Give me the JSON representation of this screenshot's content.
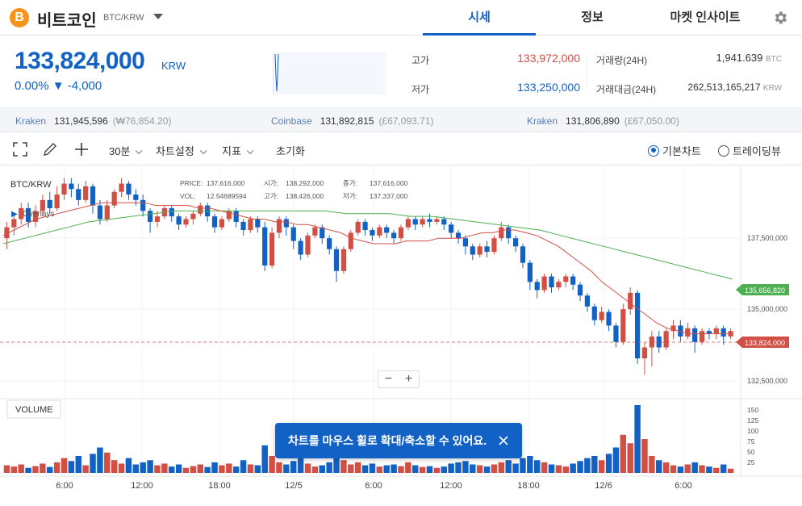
{
  "header": {
    "coin_symbol_glyph": "B",
    "coin_name": "비트코인",
    "pair": "BTC/KRW",
    "tabs": [
      {
        "label": "시세",
        "active": true
      },
      {
        "label": "정보",
        "active": false
      },
      {
        "label": "마켓 인사이트",
        "active": false
      }
    ],
    "settings_icon": "gear-icon"
  },
  "summary": {
    "price": "133,824,000",
    "unit": "KRW",
    "change": "0.00% ▼ -4,000",
    "high_label": "고가",
    "high_value": "133,972,000",
    "low_label": "저가",
    "low_value": "133,250,000",
    "volume_label": "거래량(24H)",
    "volume_value": "1,941.639",
    "volume_unit": "BTC",
    "amount_label": "거래대금(24H)",
    "amount_value": "262,513,165,217",
    "amount_unit": "KRW"
  },
  "exchanges": [
    {
      "name": "Kraken",
      "price": "131,945,596",
      "usd": "(₩76,854.20)"
    },
    {
      "name": "Coinbase",
      "price": "131,892,815",
      "usd": "(£67,093.71)"
    },
    {
      "name": "Kraken",
      "price": "131,806,890",
      "usd": "(£67,050.00)"
    }
  ],
  "toolbar": {
    "interval": "30분",
    "chart_settings": "차트설정",
    "indicators": "지표",
    "reset": "초기화",
    "basic_chart": "기본차트",
    "tradingview": "트레이딩뷰"
  },
  "chart": {
    "pair_label": "BTC/KRW",
    "overlays": "Overlays",
    "legend": {
      "price_label": "PRICE:",
      "price": "137,616,000",
      "open_label": "시가:",
      "open": "138,292,000",
      "close_label": "종가:",
      "close": "137,616,000",
      "vol_label": "VOL:",
      "vol": "12.54689594",
      "high_label": "고가:",
      "high": "138,426,000",
      "low_label": "저가:",
      "low": "137,337,000"
    },
    "y_ticks": [
      "137,500,000",
      "135,000,000",
      "132,500,000"
    ],
    "ma_long_tag": "135,656,820",
    "current_tag": "133,824,000",
    "volume_label": "VOLUME",
    "vol_ticks": [
      "150",
      "125",
      "100",
      "75",
      "50",
      "25"
    ],
    "x_ticks": [
      "6:00",
      "12:00",
      "18:00",
      "12/5",
      "6:00",
      "12:00",
      "18:00",
      "12/6",
      "6:00"
    ],
    "colors": {
      "up": "#d24f45",
      "down": "#1261c4",
      "ma_short": "#d24f45",
      "ma_long": "#4caf50"
    }
  },
  "chart_data": {
    "type": "candlestick",
    "y_range": [
      131500000,
      139600000
    ],
    "vol_range": [
      0,
      160
    ],
    "candles": [
      [
        137.2,
        137.6,
        136.8,
        137.8,
        18
      ],
      [
        137.6,
        137.9,
        137.3,
        138.1,
        15
      ],
      [
        137.9,
        138.3,
        137.7,
        138.5,
        20
      ],
      [
        138.3,
        137.8,
        137.6,
        138.5,
        12
      ],
      [
        137.8,
        138.2,
        137.6,
        138.4,
        16
      ],
      [
        138.2,
        138.6,
        138.0,
        138.8,
        22
      ],
      [
        138.6,
        138.3,
        138.1,
        138.9,
        14
      ],
      [
        138.3,
        138.8,
        138.2,
        139.1,
        25
      ],
      [
        138.8,
        139.2,
        138.6,
        139.4,
        35
      ],
      [
        139.2,
        139.0,
        138.7,
        139.4,
        28
      ],
      [
        139.0,
        138.6,
        138.4,
        139.2,
        40
      ],
      [
        138.6,
        139.1,
        138.5,
        139.3,
        18
      ],
      [
        139.1,
        138.4,
        138.1,
        139.2,
        45
      ],
      [
        138.4,
        137.9,
        137.7,
        138.6,
        60
      ],
      [
        137.9,
        138.4,
        137.8,
        138.6,
        48
      ],
      [
        138.4,
        138.9,
        138.3,
        139.0,
        30
      ],
      [
        138.9,
        139.2,
        138.7,
        139.4,
        22
      ],
      [
        139.2,
        138.8,
        138.6,
        139.3,
        35
      ],
      [
        138.8,
        138.6,
        138.4,
        139.0,
        20
      ],
      [
        138.6,
        138.2,
        138.0,
        138.8,
        25
      ],
      [
        138.2,
        137.8,
        137.4,
        138.3,
        30
      ],
      [
        137.8,
        138.0,
        137.6,
        138.2,
        18
      ],
      [
        138.0,
        138.3,
        137.9,
        138.4,
        22
      ],
      [
        138.3,
        138.0,
        137.8,
        138.4,
        15
      ],
      [
        138.0,
        137.7,
        137.5,
        138.1,
        20
      ],
      [
        137.7,
        137.9,
        137.6,
        138.0,
        12
      ],
      [
        137.9,
        138.1,
        137.7,
        138.2,
        16
      ],
      [
        138.1,
        138.4,
        138.0,
        138.5,
        20
      ],
      [
        138.4,
        138.0,
        137.8,
        138.5,
        14
      ],
      [
        138.0,
        137.6,
        137.4,
        138.1,
        25
      ],
      [
        137.6,
        137.9,
        137.5,
        138.0,
        18
      ],
      [
        137.9,
        138.2,
        137.8,
        138.3,
        22
      ],
      [
        138.2,
        137.8,
        137.6,
        138.3,
        15
      ],
      [
        137.8,
        137.5,
        137.3,
        137.9,
        30
      ],
      [
        137.5,
        137.9,
        137.4,
        138.0,
        20
      ],
      [
        137.9,
        137.6,
        137.4,
        138.0,
        18
      ],
      [
        137.6,
        136.2,
        136.0,
        137.8,
        65
      ],
      [
        136.2,
        137.4,
        136.1,
        137.6,
        40
      ],
      [
        137.4,
        137.9,
        137.2,
        138.0,
        25
      ],
      [
        137.9,
        137.6,
        137.3,
        138.0,
        20
      ],
      [
        137.6,
        137.1,
        136.8,
        137.7,
        28
      ],
      [
        137.1,
        136.6,
        136.4,
        137.2,
        35
      ],
      [
        136.6,
        137.3,
        136.5,
        137.4,
        22
      ],
      [
        137.3,
        137.6,
        137.2,
        137.7,
        15
      ],
      [
        137.6,
        137.2,
        137.0,
        137.7,
        18
      ],
      [
        137.2,
        136.8,
        136.6,
        137.3,
        25
      ],
      [
        136.8,
        136.0,
        135.6,
        136.9,
        45
      ],
      [
        136.0,
        136.8,
        135.9,
        136.9,
        30
      ],
      [
        136.8,
        137.4,
        136.7,
        137.5,
        20
      ],
      [
        137.4,
        137.8,
        137.3,
        137.9,
        25
      ],
      [
        137.8,
        137.5,
        137.3,
        137.9,
        18
      ],
      [
        137.5,
        137.3,
        137.1,
        137.6,
        22
      ],
      [
        137.3,
        137.6,
        137.2,
        137.7,
        15
      ],
      [
        137.6,
        137.4,
        137.2,
        137.7,
        18
      ],
      [
        137.4,
        137.2,
        137.0,
        137.5,
        20
      ],
      [
        137.2,
        137.6,
        137.1,
        137.7,
        16
      ],
      [
        137.6,
        137.9,
        137.5,
        138.0,
        25
      ],
      [
        137.9,
        137.7,
        137.5,
        138.0,
        18
      ],
      [
        137.7,
        137.9,
        137.6,
        138.0,
        14
      ],
      [
        137.9,
        137.8,
        137.6,
        138.1,
        16
      ],
      [
        137.8,
        137.9,
        137.7,
        138.0,
        12
      ],
      [
        137.9,
        137.7,
        137.5,
        138.0,
        15
      ],
      [
        137.7,
        137.4,
        137.2,
        137.8,
        22
      ],
      [
        137.4,
        137.2,
        137.0,
        137.5,
        25
      ],
      [
        137.2,
        136.9,
        136.6,
        137.3,
        28
      ],
      [
        136.9,
        136.6,
        136.4,
        137.0,
        20
      ],
      [
        136.6,
        136.9,
        136.5,
        137.0,
        18
      ],
      [
        136.9,
        136.7,
        136.5,
        137.1,
        15
      ],
      [
        136.7,
        137.2,
        136.6,
        137.3,
        20
      ],
      [
        137.2,
        137.6,
        137.1,
        137.8,
        25
      ],
      [
        137.6,
        137.2,
        137.0,
        137.7,
        30
      ],
      [
        137.2,
        136.9,
        136.7,
        137.3,
        22
      ],
      [
        136.9,
        136.3,
        136.1,
        137.0,
        35
      ],
      [
        136.3,
        135.6,
        135.3,
        136.4,
        40
      ],
      [
        135.6,
        135.3,
        135.0,
        135.7,
        30
      ],
      [
        135.3,
        135.8,
        135.2,
        135.9,
        25
      ],
      [
        135.8,
        135.4,
        135.2,
        135.9,
        20
      ],
      [
        135.4,
        135.6,
        135.3,
        135.7,
        18
      ],
      [
        135.6,
        135.8,
        135.4,
        135.9,
        15
      ],
      [
        135.8,
        135.5,
        135.3,
        135.9,
        22
      ],
      [
        135.5,
        135.1,
        134.9,
        135.6,
        28
      ],
      [
        135.1,
        134.7,
        134.5,
        135.2,
        35
      ],
      [
        134.7,
        134.2,
        134.0,
        134.8,
        40
      ],
      [
        134.2,
        134.5,
        134.1,
        134.7,
        30
      ],
      [
        134.5,
        134.0,
        133.8,
        134.6,
        45
      ],
      [
        134.0,
        133.4,
        133.2,
        134.1,
        60
      ],
      [
        133.4,
        134.6,
        133.3,
        134.8,
        90
      ],
      [
        134.6,
        135.2,
        134.4,
        135.4,
        70
      ],
      [
        135.2,
        132.8,
        132.6,
        135.3,
        160
      ],
      [
        132.8,
        133.2,
        132.2,
        133.4,
        80
      ],
      [
        133.2,
        133.6,
        132.5,
        133.8,
        40
      ],
      [
        133.6,
        133.2,
        133.0,
        133.8,
        30
      ],
      [
        133.2,
        133.8,
        133.1,
        133.9,
        25
      ],
      [
        133.8,
        134.0,
        133.5,
        134.2,
        18
      ],
      [
        134.0,
        133.6,
        133.4,
        134.2,
        15
      ],
      [
        133.6,
        133.9,
        133.5,
        134.1,
        20
      ],
      [
        133.9,
        133.4,
        133.0,
        134.0,
        25
      ],
      [
        133.4,
        133.8,
        133.3,
        133.9,
        18
      ],
      [
        133.8,
        133.7,
        133.5,
        133.9,
        15
      ],
      [
        133.7,
        133.9,
        133.5,
        134.0,
        12
      ],
      [
        133.9,
        133.6,
        133.3,
        134.0,
        20
      ],
      [
        133.6,
        133.8,
        133.5,
        133.9,
        10
      ]
    ],
    "ma_short": [
      137.3,
      137.5,
      137.7,
      137.9,
      138.0,
      138.1,
      138.2,
      138.3,
      138.4,
      138.5,
      138.5,
      138.5,
      138.5,
      138.5,
      138.4,
      138.4,
      138.4,
      138.4,
      138.3,
      138.3,
      138.2,
      138.1,
      138.0,
      137.9,
      137.9,
      137.8,
      137.8,
      137.7,
      137.7,
      137.6,
      137.5,
      137.4,
      137.2,
      137.1,
      137.0,
      137.0,
      137.0,
      137.1,
      137.1,
      137.1,
      137.2,
      137.2,
      137.2,
      137.3,
      137.4,
      137.4,
      137.5,
      137.5,
      137.4,
      137.3,
      137.1,
      136.9,
      136.6,
      136.3,
      136.0,
      135.6,
      135.3,
      135.0,
      134.7,
      134.4,
      134.1,
      133.9,
      133.8,
      133.7,
      133.7,
      133.7,
      133.7,
      133.7
    ],
    "ma_long": [
      137.0,
      137.2,
      137.4,
      137.6,
      137.8,
      137.9,
      138.0,
      138.1,
      138.2,
      138.2,
      138.2,
      138.2,
      138.2,
      138.2,
      138.2,
      138.2,
      138.1,
      138.1,
      138.1,
      138.0,
      138.0,
      137.9,
      137.8,
      137.7,
      137.6,
      137.5,
      137.3,
      137.1,
      136.9,
      136.7,
      136.5,
      136.3,
      136.1,
      135.9,
      135.7
    ]
  }
}
